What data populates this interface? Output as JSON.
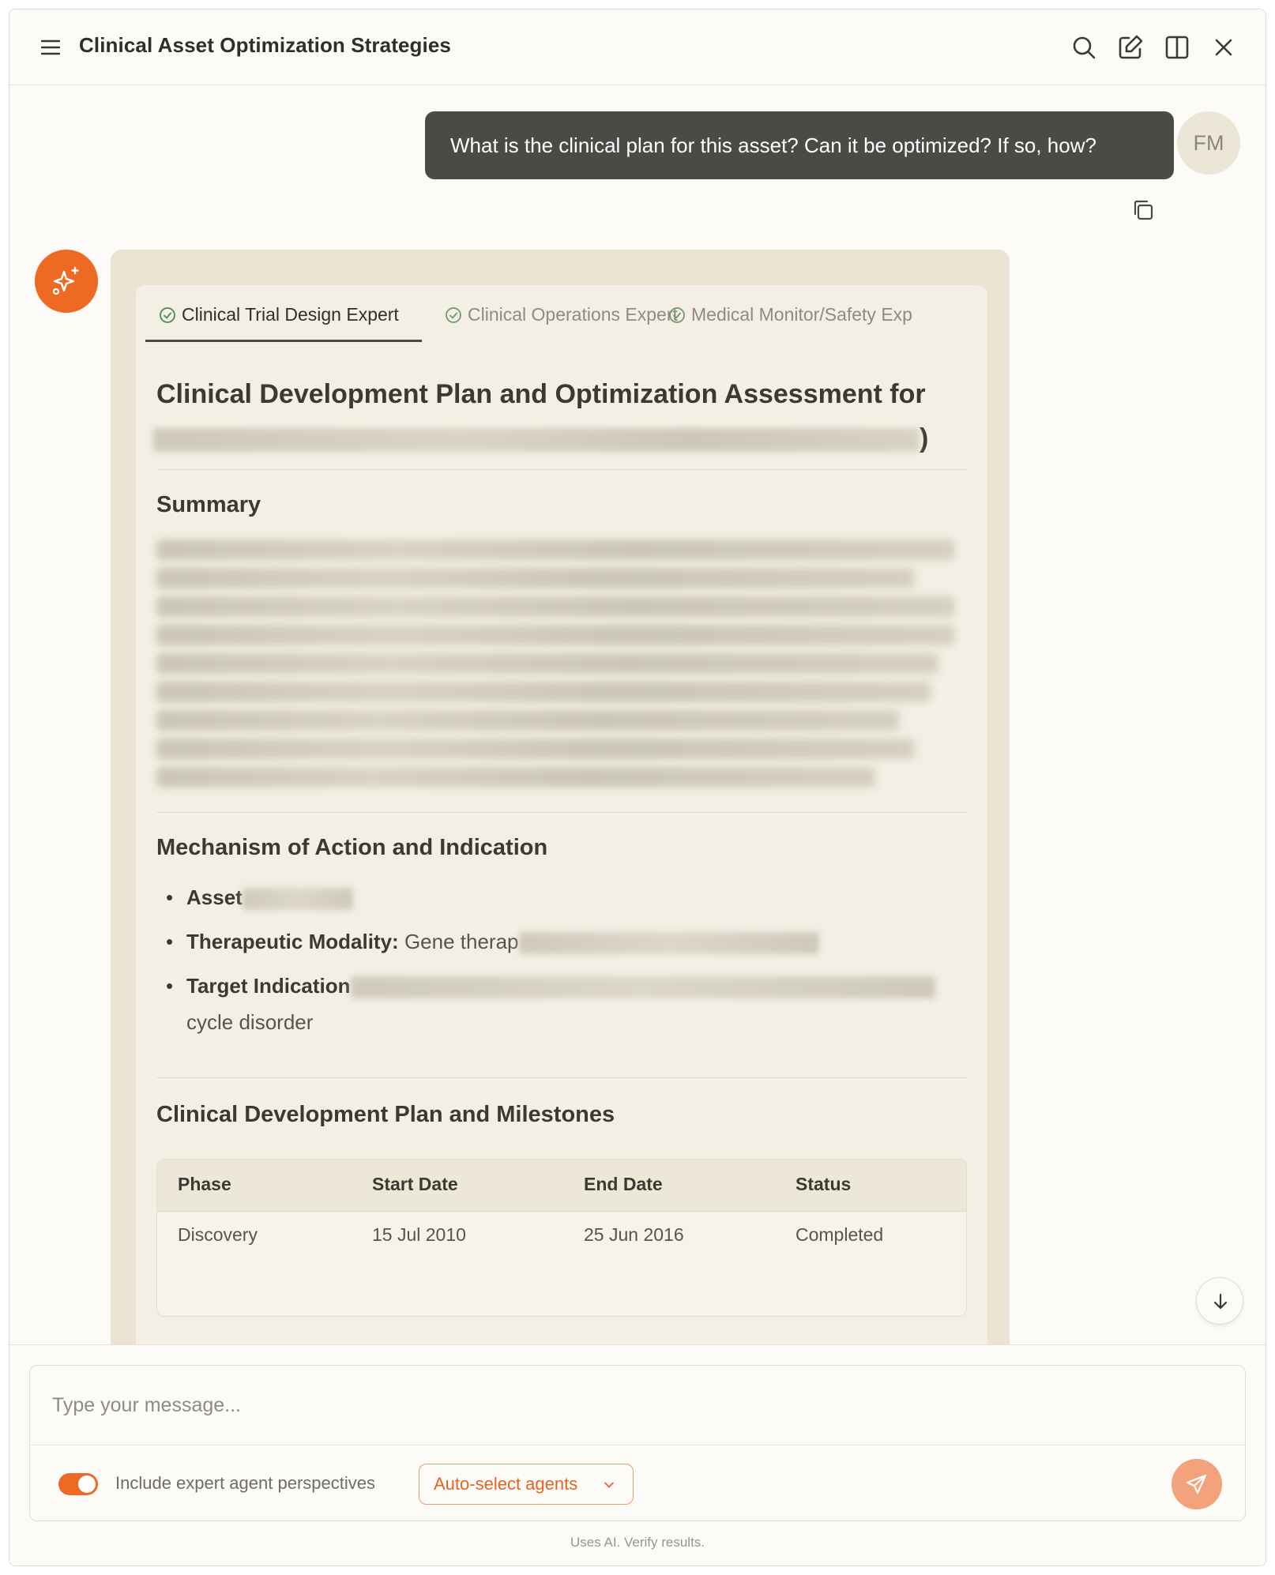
{
  "header": {
    "title": "Clinical Asset Optimization Strategies",
    "icons": [
      "menu-icon",
      "search-icon",
      "edit-icon",
      "split-view-icon",
      "close-icon"
    ]
  },
  "user_message": {
    "text": "What is the clinical plan for this asset? Can it be optimized? If so, how?",
    "avatar_initials": "FM"
  },
  "assistant": {
    "tabs": [
      {
        "label": "Clinical Trial Design Expert",
        "active": true
      },
      {
        "label": "Clinical Operations Expert",
        "active": false
      },
      {
        "label": "Medical Monitor/Safety Exp",
        "active": false
      }
    ],
    "doc_title": "Clinical Development Plan and Optimization Assessment for",
    "doc_title_end": ")",
    "summary_heading": "Summary",
    "mechanism_heading": "Mechanism of Action and Indication",
    "bullets": [
      {
        "label": "Asset",
        "value": ""
      },
      {
        "label": "Therapeutic Modality:",
        "value": "Gene therap"
      },
      {
        "label": "Target Indication",
        "value": "",
        "continuation": "cycle disorder"
      }
    ],
    "plan_heading": "Clinical Development Plan and Milestones",
    "table": {
      "columns": [
        "Phase",
        "Start Date",
        "End Date",
        "Status"
      ],
      "rows": [
        [
          "Discovery",
          "15 Jul 2010",
          "25 Jun 2016",
          "Completed"
        ]
      ]
    }
  },
  "composer": {
    "placeholder": "Type your message...",
    "toggle_label": "Include expert agent perspectives",
    "toggle_on": true,
    "agents_button": "Auto-select agents",
    "footer": "Uses AI. Verify results."
  },
  "colors": {
    "accent": "#ee6a24",
    "user_bubble": "#4a4b46",
    "card_bg": "#ebe4d2",
    "inner_bg": "#f3efe4"
  }
}
